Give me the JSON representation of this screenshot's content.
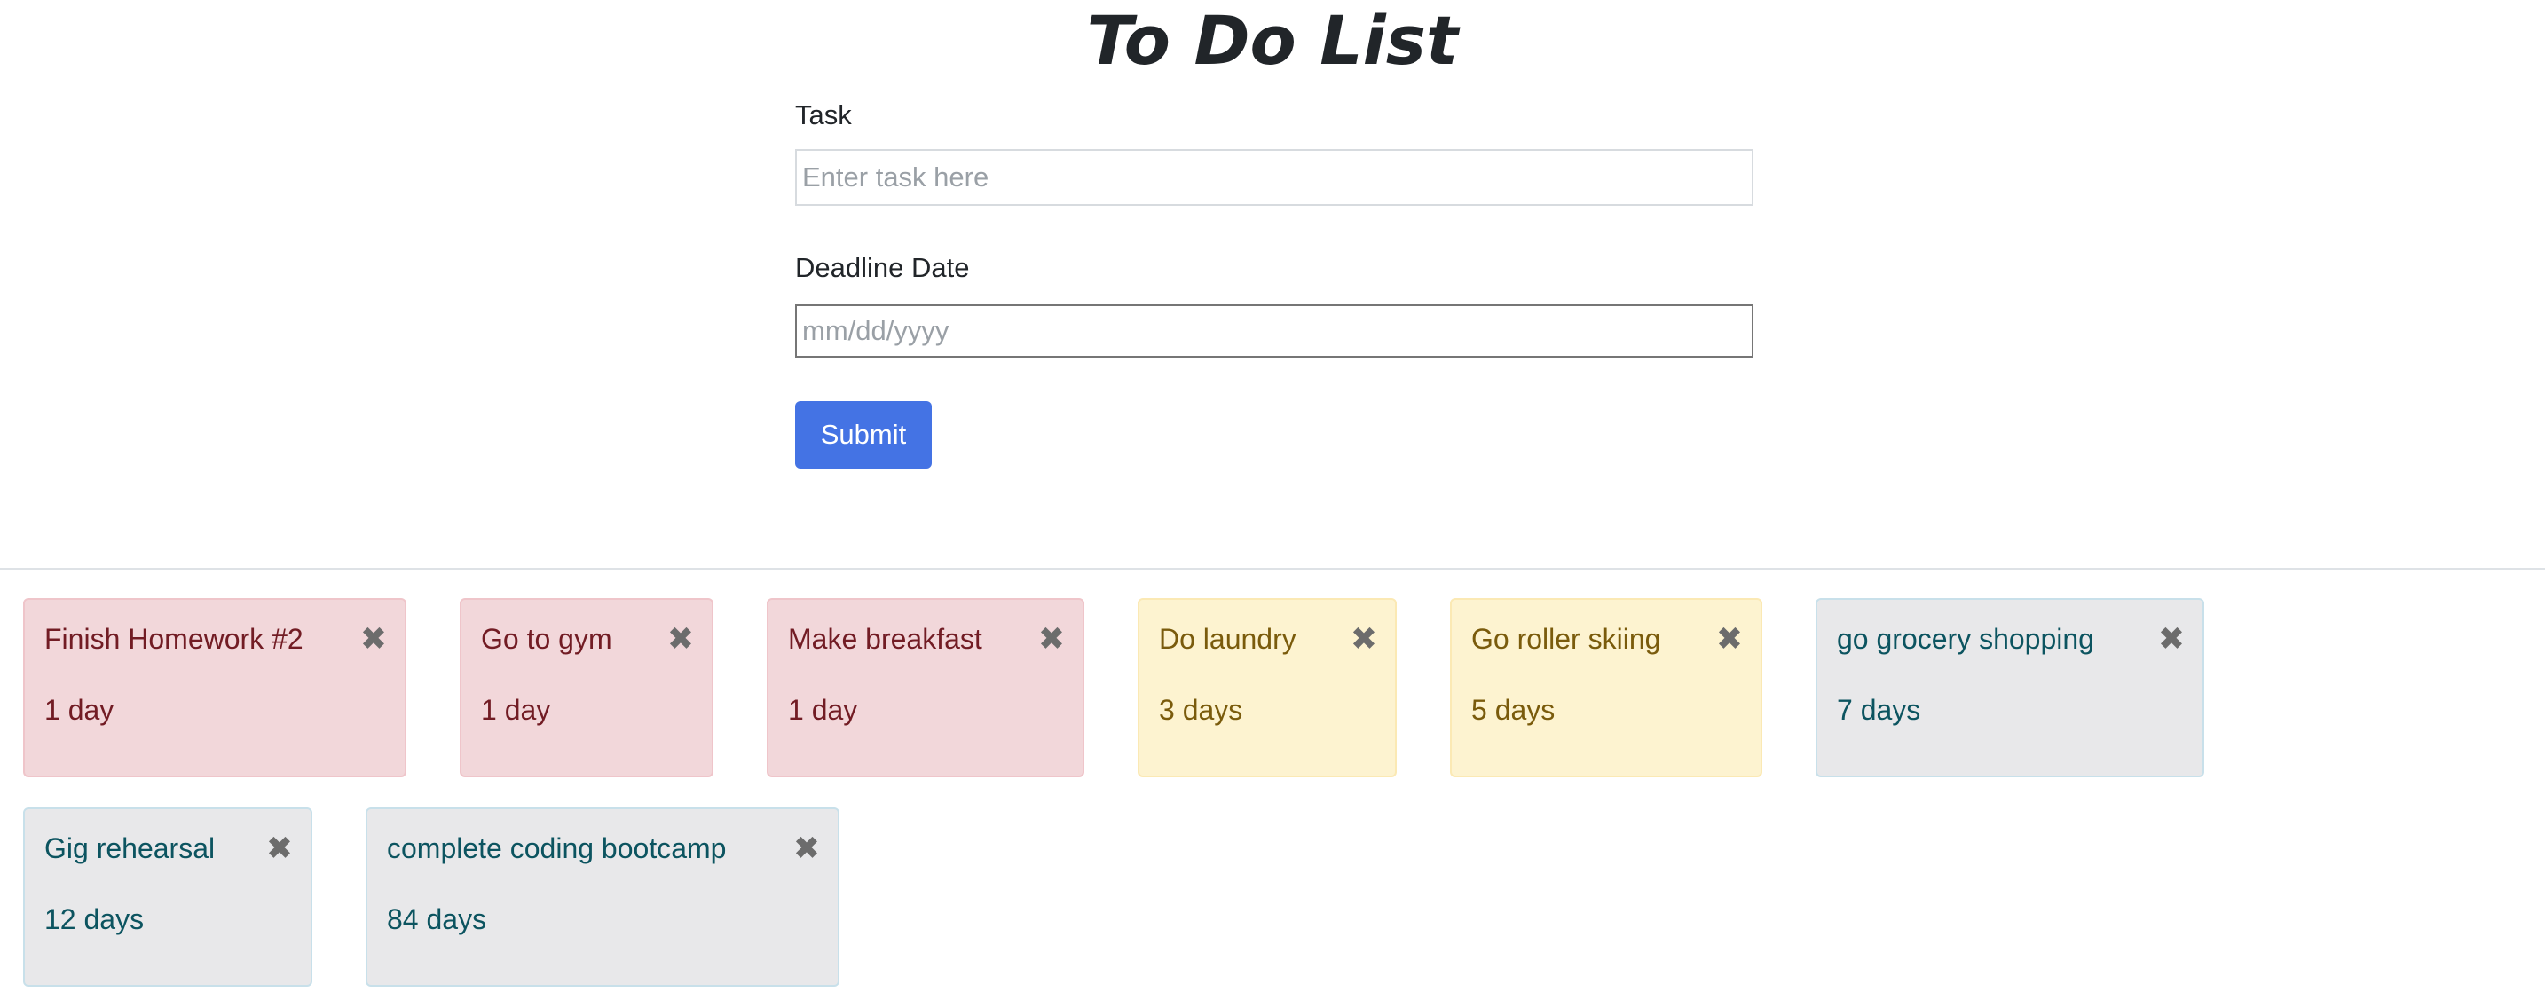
{
  "page": {
    "title": "To Do List"
  },
  "form": {
    "task_label": "Task",
    "task_placeholder": "Enter task here",
    "task_value": "",
    "date_label": "Deadline Date",
    "date_placeholder": "mm/dd/yyyy",
    "date_value": "",
    "submit_label": "Submit"
  },
  "icons": {
    "close": "close-icon"
  },
  "colors": {
    "primary": "#4473e4",
    "danger_bg": "#f2d7da",
    "danger_text": "#721c24",
    "warning_bg": "#fdf3d0",
    "warning_text": "#7a5b0c",
    "info_bg": "#e8e8ea",
    "info_text": "#0c5460"
  },
  "tasks": [
    {
      "title": "Finish Homework #2",
      "days": "1 day",
      "status": "danger",
      "close": "✖"
    },
    {
      "title": "Go to gym",
      "days": "1 day",
      "status": "danger",
      "close": "✖"
    },
    {
      "title": "Make breakfast",
      "days": "1 day",
      "status": "danger",
      "close": "✖"
    },
    {
      "title": "Do laundry",
      "days": "3 days",
      "status": "warning",
      "close": "✖"
    },
    {
      "title": "Go roller skiing",
      "days": "5 days",
      "status": "warning",
      "close": "✖"
    },
    {
      "title": "go grocery shopping",
      "days": "7 days",
      "status": "info",
      "close": "✖"
    },
    {
      "title": "Gig rehearsal",
      "days": "12 days",
      "status": "info",
      "close": "✖"
    },
    {
      "title": "complete coding bootcamp",
      "days": "84 days",
      "status": "info",
      "close": "✖"
    }
  ]
}
